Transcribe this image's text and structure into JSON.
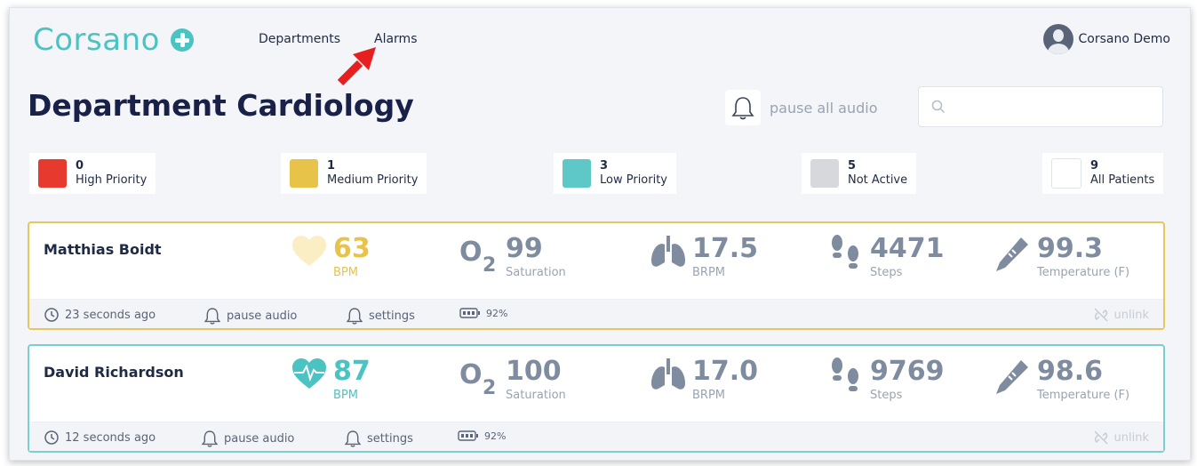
{
  "brand": {
    "name": "Corsano",
    "accent": "#4cc3c3"
  },
  "nav": {
    "departments": "Departments",
    "alarms": "Alarms"
  },
  "user": {
    "name": "Corsano Demo"
  },
  "page": {
    "title": "Department Cardiology"
  },
  "controls": {
    "pause_all": "pause all audio",
    "search_placeholder": ""
  },
  "priorities": [
    {
      "count": "0",
      "label": "High Priority",
      "color": "#e8392f"
    },
    {
      "count": "1",
      "label": "Medium Priority",
      "color": "#e8c34a"
    },
    {
      "count": "3",
      "label": "Low Priority",
      "color": "#5ec7c7"
    },
    {
      "count": "5",
      "label": "Not Active",
      "color": "#d6d8dc"
    },
    {
      "count": "9",
      "label": "All Patients",
      "color": "#ffffff"
    }
  ],
  "patients": [
    {
      "name": "Matthias Boidt",
      "status_color": "#e8c75a",
      "hr": {
        "value": "63",
        "unit": "BPM",
        "color": "#e8c34a"
      },
      "spo2": {
        "value": "99",
        "unit": "Saturation"
      },
      "resp": {
        "value": "17.5",
        "unit": "BRPM"
      },
      "steps": {
        "value": "4471",
        "unit": "Steps"
      },
      "temp": {
        "value": "99.3",
        "unit": "Temperature (F)"
      },
      "last_update": "23 seconds ago",
      "pause_audio": "pause audio",
      "settings": "settings",
      "battery": "92%",
      "unlink": "unlink"
    },
    {
      "name": "David Richardson",
      "status_color": "#7ccfcf",
      "hr": {
        "value": "87",
        "unit": "BPM",
        "color": "#4cc3c3"
      },
      "spo2": {
        "value": "100",
        "unit": "Saturation"
      },
      "resp": {
        "value": "17.0",
        "unit": "BRPM"
      },
      "steps": {
        "value": "9769",
        "unit": "Steps"
      },
      "temp": {
        "value": "98.6",
        "unit": "Temperature (F)"
      },
      "last_update": "12 seconds ago",
      "pause_audio": "pause audio",
      "settings": "settings",
      "battery": "92%",
      "unlink": "unlink"
    }
  ],
  "icons": [
    "plus-circle-icon",
    "red-arrow-icon",
    "avatar-icon",
    "bell-icon",
    "search-icon",
    "heart-icon",
    "o2-icon",
    "lungs-icon",
    "footprints-icon",
    "thermometer-pen-icon",
    "history-icon",
    "battery-icon",
    "unlink-icon"
  ]
}
